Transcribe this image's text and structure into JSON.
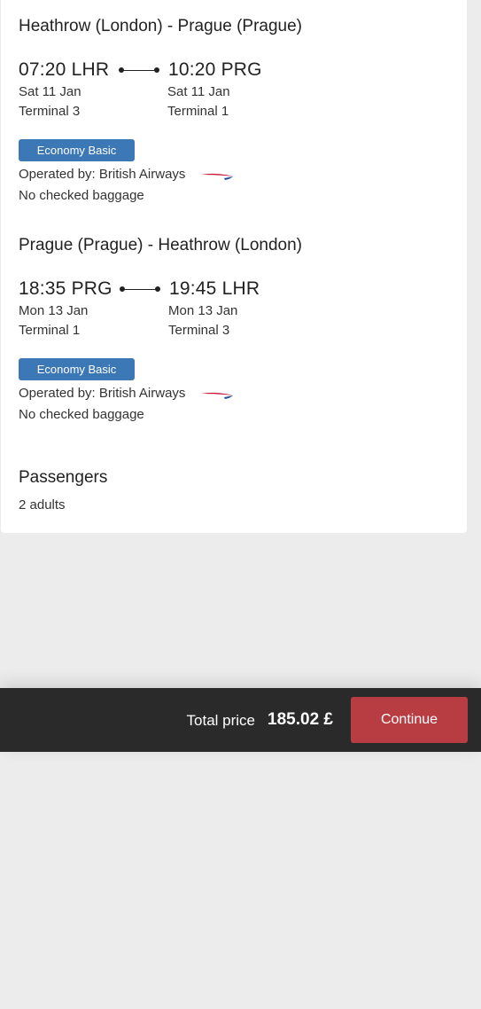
{
  "outbound": {
    "route": "Heathrow (London) - Prague (Prague)",
    "depart_time": "07:20 LHR",
    "depart_date": "Sat 11 Jan",
    "depart_terminal": "Terminal 3",
    "arrive_time": "10:20 PRG",
    "arrive_date": "Sat 11 Jan",
    "arrive_terminal": "Terminal 1",
    "fare_class": "Economy Basic",
    "operated_by": "Operated by: British Airways",
    "baggage": "No checked baggage",
    "airline_icon": "british-airways-speedmarque"
  },
  "inbound": {
    "route": "Prague (Prague) - Heathrow (London)",
    "depart_time": "18:35 PRG",
    "depart_date": "Mon 13 Jan",
    "depart_terminal": "Terminal 1",
    "arrive_time": "19:45 LHR",
    "arrive_date": "Mon 13 Jan",
    "arrive_terminal": "Terminal 3",
    "fare_class": "Economy Basic",
    "operated_by": "Operated by: British Airways",
    "baggage": "No checked baggage",
    "airline_icon": "british-airways-speedmarque"
  },
  "passengers": {
    "title": "Passengers",
    "value": "2 adults"
  },
  "footer": {
    "total_label": "Total price",
    "total_value": "185.02 £",
    "continue_label": "Continue"
  },
  "colors": {
    "badge": "#3d78b6",
    "continue_button": "#b83d43",
    "footer_bg": "#2a2a2a",
    "page_bg": "#ececec"
  }
}
